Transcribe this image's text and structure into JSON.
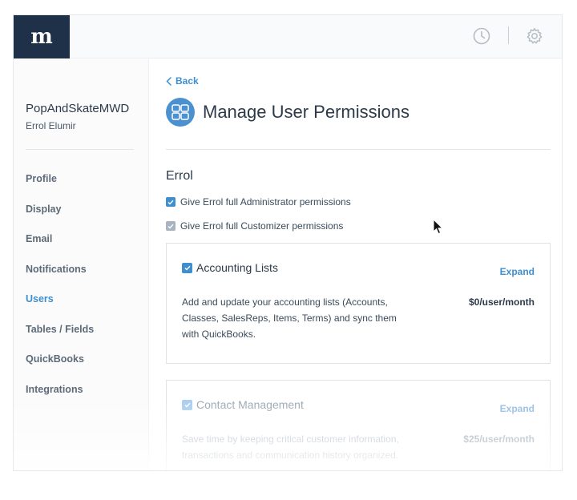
{
  "brand": {
    "logo_text": "m"
  },
  "topbar": {
    "history_icon": "clock-icon",
    "settings_icon": "gear-icon"
  },
  "sidebar": {
    "account_name": "PopAndSkateMWD",
    "account_user": "Errol Elumir",
    "items": [
      {
        "label": "Profile",
        "active": false
      },
      {
        "label": "Display",
        "active": false
      },
      {
        "label": "Email",
        "active": false
      },
      {
        "label": "Notifications",
        "active": false
      },
      {
        "label": "Users",
        "active": true
      },
      {
        "label": "Tables / Fields",
        "active": false
      },
      {
        "label": "QuickBooks",
        "active": false
      },
      {
        "label": "Integrations",
        "active": false
      }
    ]
  },
  "main": {
    "back_label": "Back",
    "title": "Manage User Permissions",
    "title_icon": "grid-icon",
    "user_name": "Errol",
    "admin_permission_label": "Give Errol full Administrator permissions",
    "customizer_permission_label": "Give Errol full Customizer permissions",
    "cards": [
      {
        "title": "Accounting Lists",
        "expand_label": "Expand",
        "description": "Add and update your accounting lists (Accounts, Classes, SalesReps, Items, Terms) and sync them with QuickBooks.",
        "price": "$0/user/month"
      },
      {
        "title": "Contact Management",
        "expand_label": "Expand",
        "description": "Save time by keeping critical customer information, transactions and communication history organized.",
        "price": "$25/user/month"
      }
    ]
  },
  "colors": {
    "brand_dark": "#1f3148",
    "accent_blue": "#3e8fd0",
    "checkbox_gray": "#a8b4c0"
  }
}
